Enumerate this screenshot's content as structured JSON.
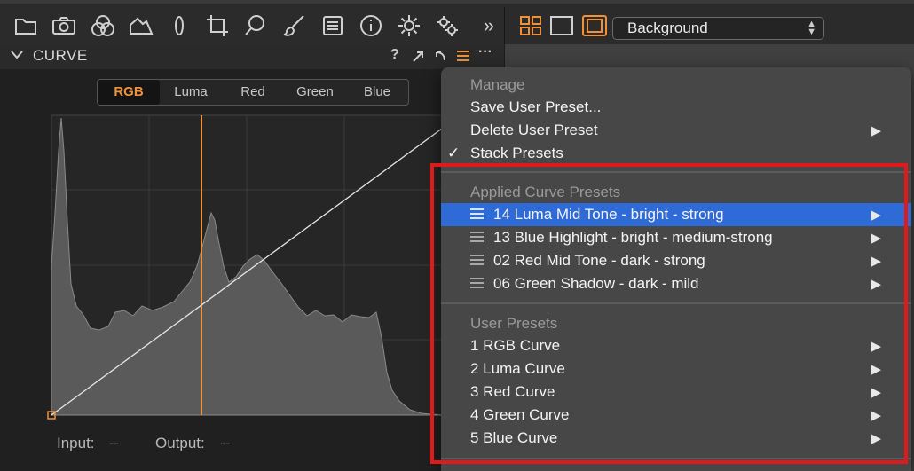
{
  "toolbar": {
    "icons": [
      "folder-icon",
      "camera-icon",
      "color-circles-icon",
      "shape-icon",
      "ellipse-icon",
      "crop-icon",
      "search-icon",
      "brush-icon",
      "list-icon",
      "info-icon",
      "gear-icon",
      "gears-icon",
      "expand-icon"
    ],
    "overflow": "»",
    "view_icons": [
      "grid-view-icon",
      "single-view-icon",
      "framed-view-icon"
    ],
    "layer_select": "Background",
    "accent": "#f0923a"
  },
  "panel": {
    "title": "CURVE",
    "help": "?",
    "channels": [
      "RGB",
      "Luma",
      "Red",
      "Green",
      "Blue"
    ],
    "active_channel": "RGB",
    "input_label": "Input:",
    "input_value": "--",
    "output_label": "Output:",
    "output_value": "--"
  },
  "menu": {
    "manage_header": "Manage",
    "save_preset": "Save User Preset...",
    "delete_preset": "Delete User Preset",
    "stack_presets": "Stack Presets",
    "stack_check": "✓",
    "applied_header": "Applied Curve Presets",
    "applied": [
      "14 Luma Mid Tone - bright - strong",
      "13 Blue Highlight - bright - medium-strong",
      "02 Red Mid Tone - dark - strong",
      "06 Green Shadow - dark - mild"
    ],
    "user_header": "User Presets",
    "user": [
      "1 RGB Curve",
      "2 Luma Curve",
      "3 Red Curve",
      "4 Green Curve",
      "5 Blue Curve"
    ],
    "submenu_arrow": "▶",
    "highlight_color": "#2f6bd6"
  }
}
